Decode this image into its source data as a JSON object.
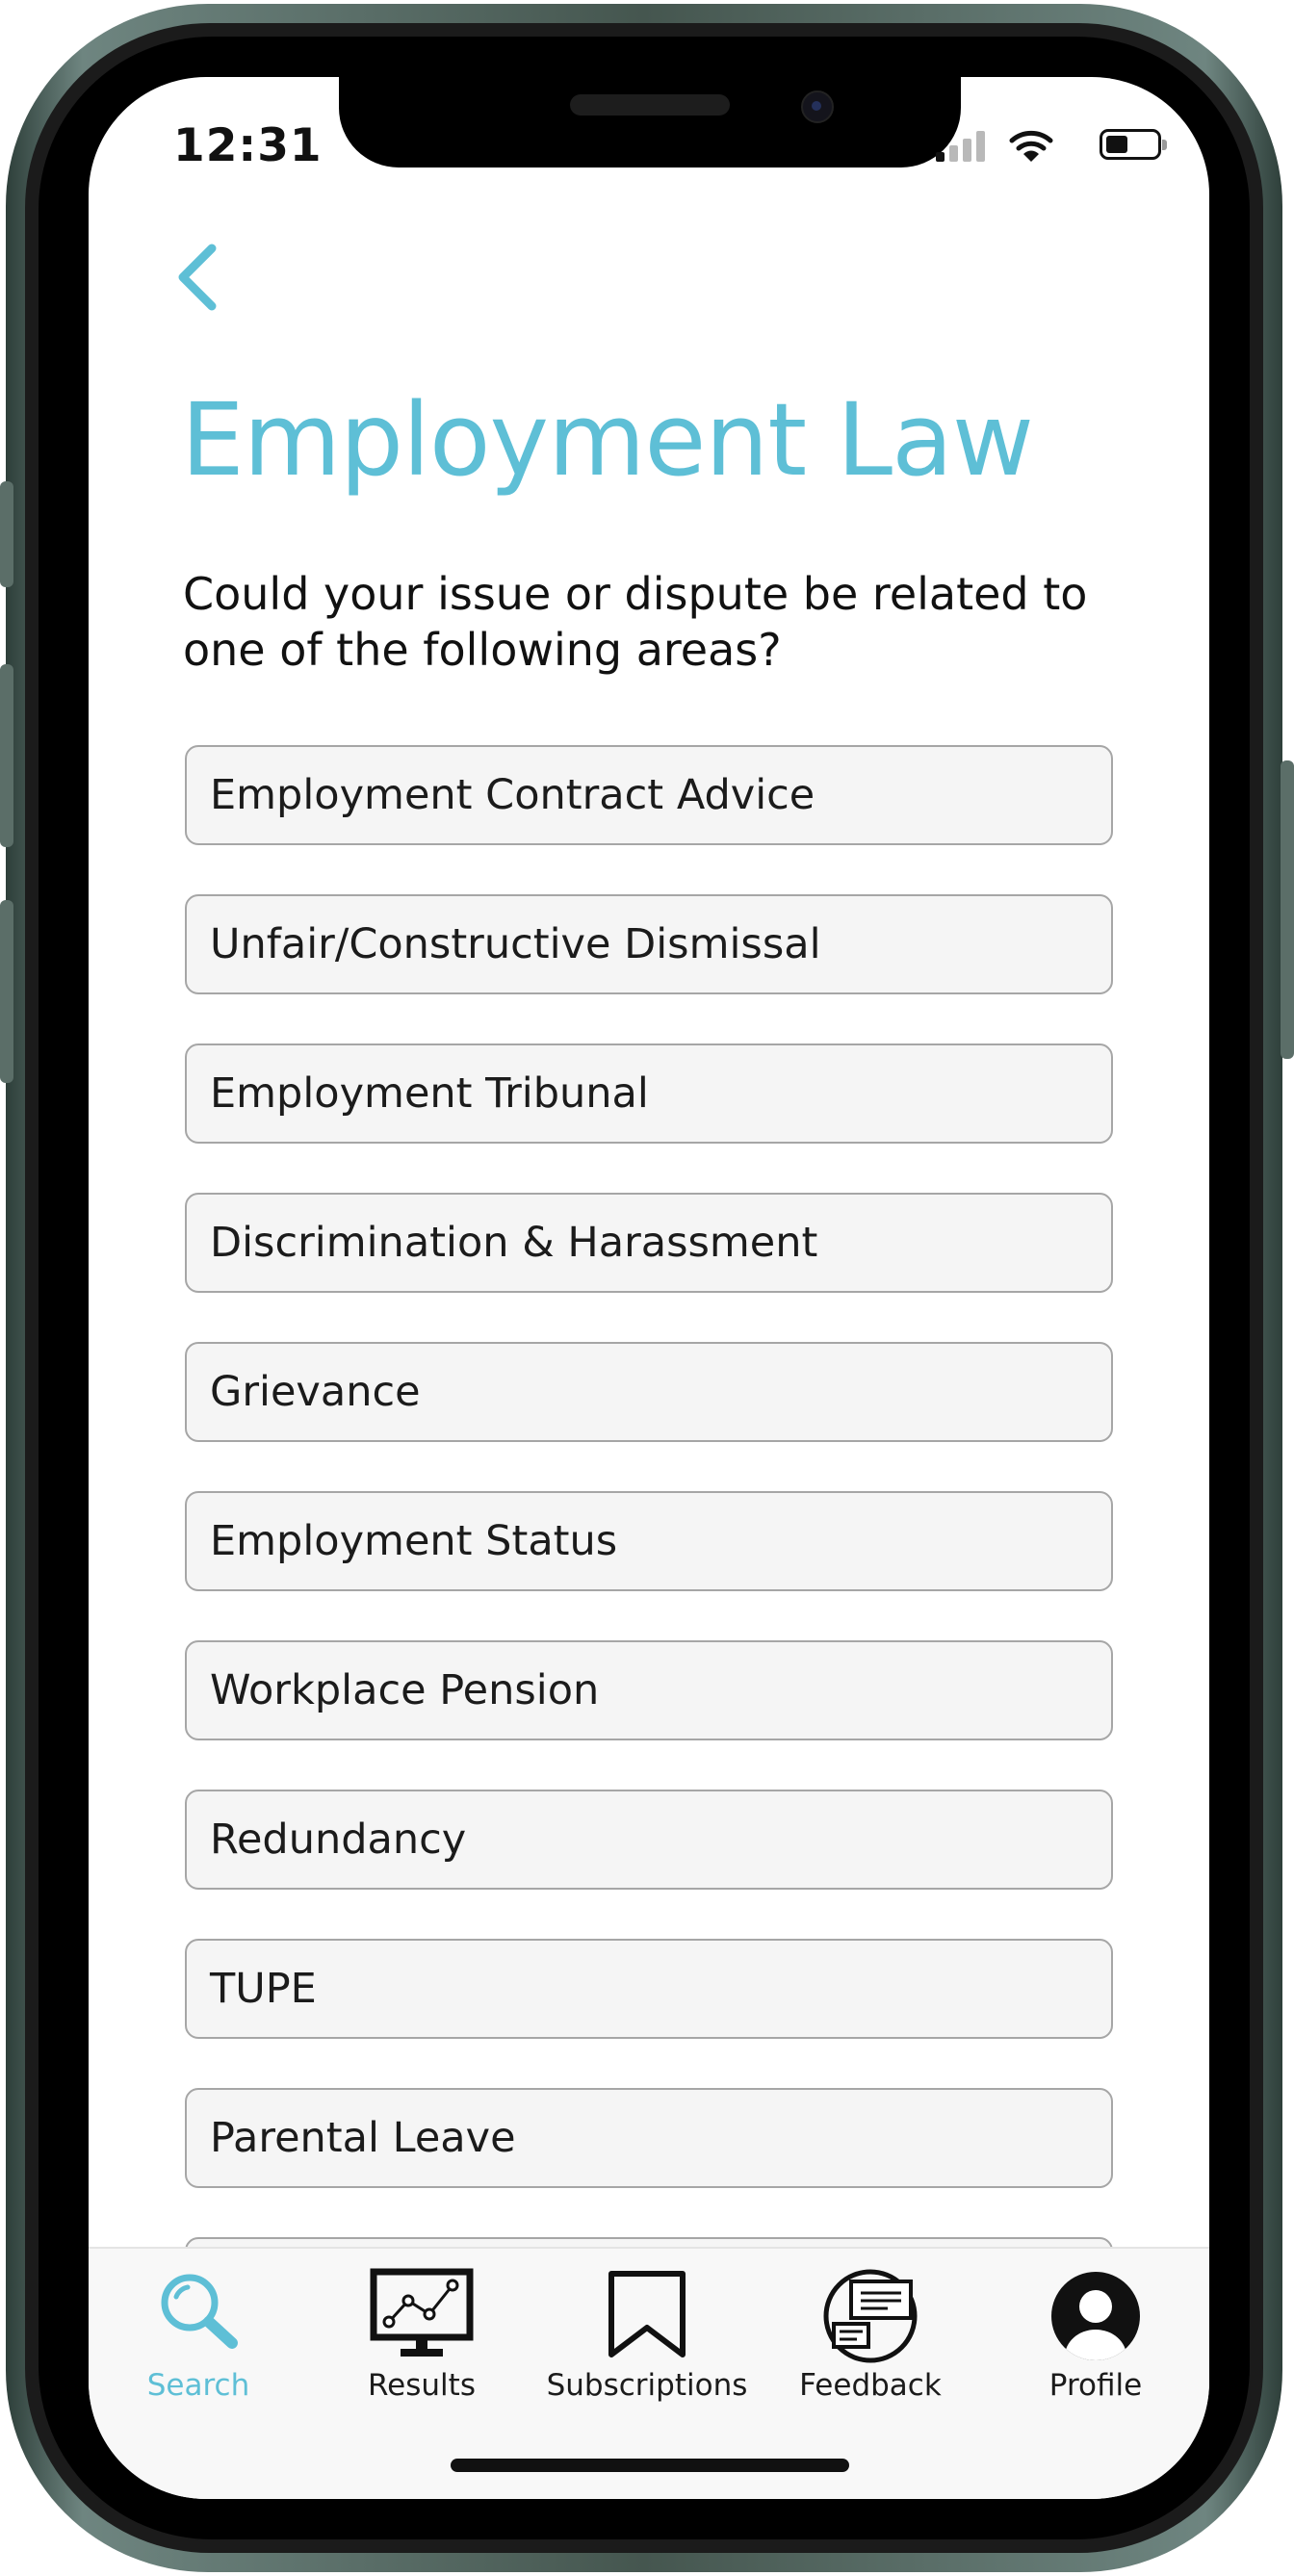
{
  "status_bar": {
    "time": "12:31"
  },
  "header": {
    "title": "Employment Law",
    "question": "Could your issue or dispute be related to one of the following areas?"
  },
  "options": [
    {
      "label": "Employment Contract Advice"
    },
    {
      "label": "Unfair/Constructive Dismissal"
    },
    {
      "label": "Employment Tribunal"
    },
    {
      "label": "Discrimination & Harassment"
    },
    {
      "label": "Grievance"
    },
    {
      "label": "Employment Status"
    },
    {
      "label": "Workplace Pension"
    },
    {
      "label": "Redundancy"
    },
    {
      "label": "TUPE"
    },
    {
      "label": "Parental Leave"
    },
    {
      "label": ""
    }
  ],
  "tabbar": {
    "tabs": [
      {
        "label": "Search",
        "icon": "search-icon",
        "active": true
      },
      {
        "label": "Results",
        "icon": "monitor-chart-icon",
        "active": false
      },
      {
        "label": "Subscriptions",
        "icon": "bookmark-icon",
        "active": false
      },
      {
        "label": "Feedback",
        "icon": "chat-bubbles-icon",
        "active": false
      },
      {
        "label": "Profile",
        "icon": "user-icon",
        "active": false
      }
    ]
  },
  "colors": {
    "accent": "#5ebfd6",
    "text": "#111111",
    "option_bg": "#f5f5f5",
    "option_border": "#a6a6a6",
    "tabbar_bg": "#f8f8f8"
  }
}
